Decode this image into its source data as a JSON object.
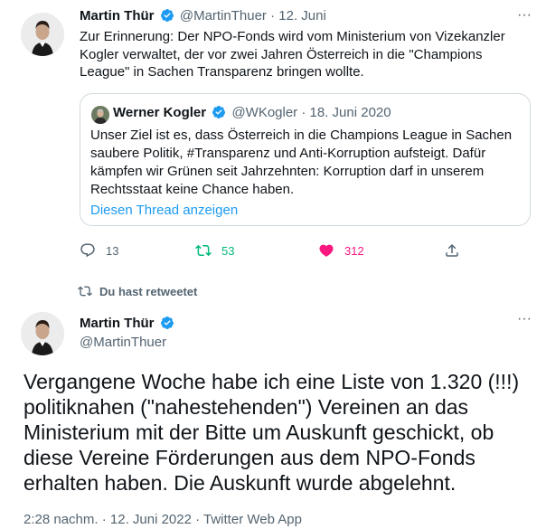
{
  "tweet1": {
    "author_name": "Martin Thür",
    "handle": "@MartinThuer",
    "separator": "·",
    "date": "12. Juni",
    "text": "Zur Erinnerung: Der NPO-Fonds wird vom Ministerium von Vizekanzler Kogler verwaltet, der vor zwei Jahren Österreich in die \"Champions League\" in Sachen Transparenz bringen wollte.",
    "more_icon": "more-dots-icon",
    "quote": {
      "author_name": "Werner Kogler",
      "handle": "@WKogler",
      "separator": "·",
      "date": "18. Juni 2020",
      "text": "Unser Ziel ist es, dass Österreich in die Champions League in Sachen saubere Politik, #Transparenz und Anti-Korruption aufsteigt. Dafür kämpfen wir Grünen seit Jahrzehnten: Korruption darf in unserem Rechtsstaat keine Chance haben.",
      "show_thread": "Diesen Thread anzeigen"
    },
    "actions": {
      "replies": "13",
      "retweets": "53",
      "likes": "312"
    }
  },
  "retweet_banner": "Du hast retweetet",
  "tweet2": {
    "author_name": "Martin Thür",
    "handle": "@MartinThuer",
    "text": "Vergangene Woche habe ich eine Liste von 1.320 (!!!) politiknahen  (\"nahestehenden\") Vereinen an das Ministerium mit der Bitte um Auskunft geschickt, ob diese Vereine Förderungen aus dem NPO-Fonds erhalten haben. Die Auskunft wurde abgelehnt.",
    "meta": "2:28 nachm. · 12. Juni 2022 · Twitter Web App"
  },
  "colors": {
    "accent": "#1d9bf0",
    "retweet": "#00ba7c",
    "like": "#f91880",
    "muted": "#536471",
    "border": "#cfd9de"
  }
}
